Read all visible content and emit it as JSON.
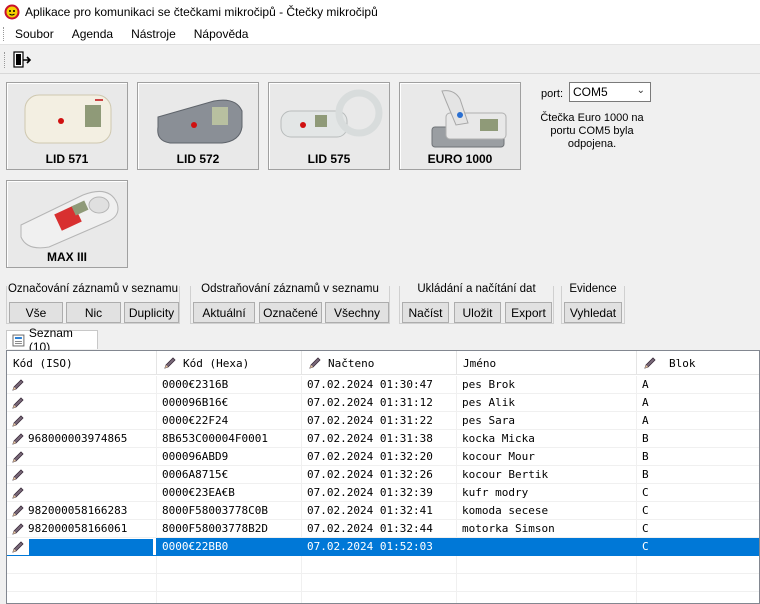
{
  "window": {
    "title": "Aplikace pro komunikaci se čtečkami mikročipů - Čtečky mikročipů"
  },
  "menu": {
    "items": [
      "Soubor",
      "Agenda",
      "Nástroje",
      "Nápověda"
    ]
  },
  "devices": [
    "LID 571",
    "LID 572",
    "LID 575",
    "EURO 1000",
    "MAX III"
  ],
  "port": {
    "label": "port:",
    "value": "COM5",
    "status": "Čtečka Euro 1000 na portu COM5 byla odpojena."
  },
  "groups": {
    "oznacovani": {
      "title": "Označování záznamů v seznamu",
      "buttons": [
        "Vše",
        "Nic",
        "Duplicity"
      ]
    },
    "odstranovani": {
      "title": "Odstraňování záznamů v seznamu",
      "buttons": [
        "Aktuální",
        "Označené",
        "Všechny"
      ]
    },
    "ukladani": {
      "title": "Ukládání a načítání dat",
      "buttons": [
        "Načíst",
        "Uložit",
        "Export"
      ]
    },
    "evidence": {
      "title": "Evidence",
      "buttons": [
        "Vyhledat"
      ]
    }
  },
  "tab": {
    "label": "Seznam (10)"
  },
  "table": {
    "columns": [
      "Kód (ISO)",
      "Kód (Hexa)",
      "Načteno",
      "Jméno",
      "Blok"
    ],
    "rows": [
      {
        "iso": "",
        "hexa": "0000€2316B",
        "loaded": "07.02.2024 01:30:47",
        "name": "pes Brok",
        "block": "A"
      },
      {
        "iso": "",
        "hexa": "000096B16€",
        "loaded": "07.02.2024 01:31:12",
        "name": "pes Alik",
        "block": "A"
      },
      {
        "iso": "",
        "hexa": "0000€22F24",
        "loaded": "07.02.2024 01:31:22",
        "name": "pes Sara",
        "block": "A"
      },
      {
        "iso": "968000003974865",
        "hexa": "8B653C00004F0001",
        "loaded": "07.02.2024 01:31:38",
        "name": "kocka Micka",
        "block": "B"
      },
      {
        "iso": "",
        "hexa": "000096ABD9",
        "loaded": "07.02.2024 01:32:20",
        "name": "kocour Mour",
        "block": "B"
      },
      {
        "iso": "",
        "hexa": "0006A8715€",
        "loaded": "07.02.2024 01:32:26",
        "name": "kocour Bertik",
        "block": "B"
      },
      {
        "iso": "",
        "hexa": "0000€23EA€B",
        "loaded": "07.02.2024 01:32:39",
        "name": "kufr modry",
        "block": "C"
      },
      {
        "iso": "982000058166283",
        "hexa": "8000F58003778C0B",
        "loaded": "07.02.2024 01:32:41",
        "name": "komoda secese",
        "block": "C"
      },
      {
        "iso": "982000058166061",
        "hexa": "8000F58003778B2D",
        "loaded": "07.02.2024 01:32:44",
        "name": "motorka Simson",
        "block": "C"
      },
      {
        "iso": "",
        "hexa": "0000€22BB0",
        "loaded": "07.02.2024 01:52:03",
        "name": "",
        "block": "C"
      }
    ],
    "selected_index": 9
  }
}
